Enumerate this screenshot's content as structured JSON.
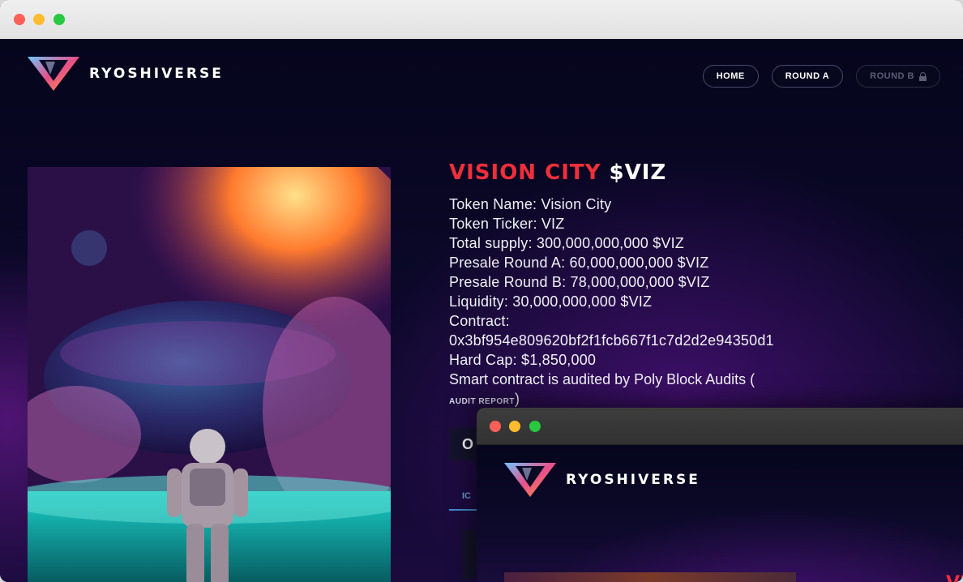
{
  "brand": {
    "name": "RYOSHIVERSE"
  },
  "nav": {
    "home": "HOME",
    "round_a": "ROUND A",
    "round_b": "ROUND B",
    "round_b_icon": "lock-icon"
  },
  "token": {
    "title_red": "VISION CITY",
    "title_white": "$VIZ",
    "lines": [
      "Token Name: Vision City",
      "Token Ticker: VIZ",
      "Total supply: 300,000,000,000 $VIZ",
      "Presale Round A: 60,000,000,000 $VIZ",
      "Presale Round B: 78,000,000,000 $VIZ",
      "Liquidity: 30,000,000,000 $VIZ",
      "Contract:",
      "0x3bf954e809620bf2f1fcb667f1c7d2d2e94350d1",
      "Hard Cap: $1,850,000"
    ],
    "audit_text": "Smart contract is audited by Poly Block Audits (",
    "audit_link": "AUDIT REPORT",
    "audit_close": ")"
  },
  "partial": {
    "card_letter": "O",
    "tab_label": "IC"
  },
  "window2": {
    "brand": "RYOSHIVERSE",
    "partial_title": "VIS"
  },
  "colors": {
    "accent_red": "#f02f3a",
    "tab_blue": "#3f8bd0",
    "bg_dark": "#07061f"
  }
}
